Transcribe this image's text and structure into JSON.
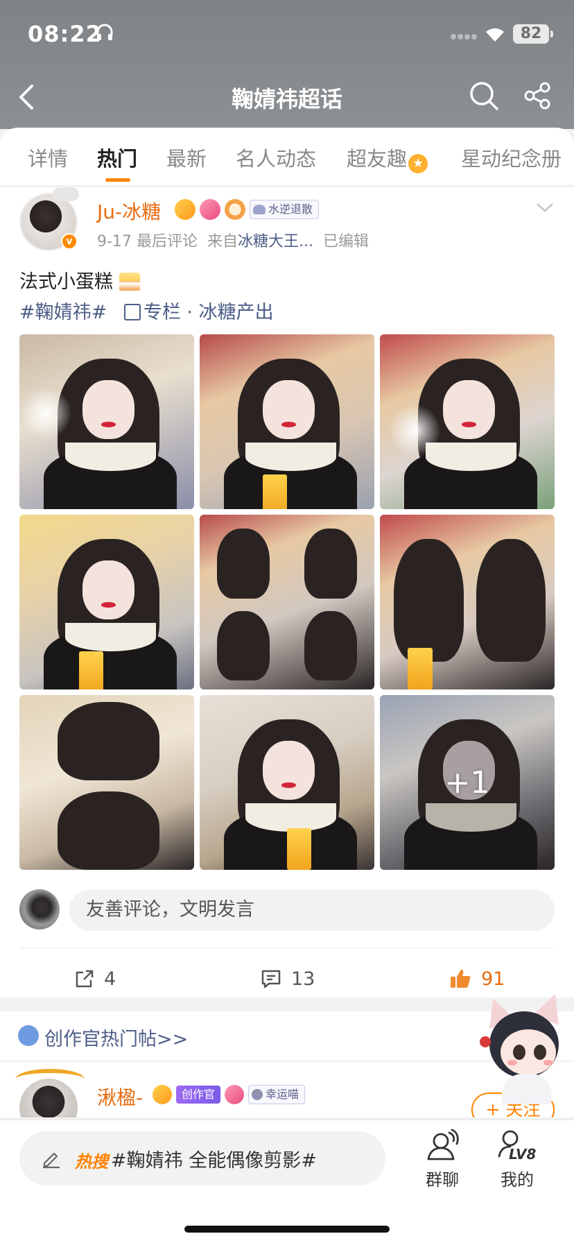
{
  "status_bar": {
    "time": "08:22",
    "battery": "82"
  },
  "nav": {
    "title": "鞠婧祎超话"
  },
  "tabs": [
    {
      "label": "详情",
      "active": false
    },
    {
      "label": "热门",
      "active": true
    },
    {
      "label": "最新",
      "active": false
    },
    {
      "label": "名人动态",
      "active": false
    },
    {
      "label": "超友趣",
      "active": false
    },
    {
      "label": "星动纪念册",
      "active": false
    }
  ],
  "post": {
    "author": "Ju-冰糖",
    "badge_tag": "水逆退散",
    "meta_date": "9-17",
    "meta_last": "最后评论",
    "meta_from": "来自",
    "meta_source": "冰糖大王...",
    "meta_edited": "已编辑",
    "text": "法式小蛋糕",
    "hashtag": "#鞠婧祎#",
    "column": "专栏 · 冰糖产出",
    "more_photos": "+1",
    "comment_placeholder": "友善评论，文明发言",
    "reposts": "4",
    "comments": "13",
    "likes": "91"
  },
  "hot_section": {
    "label": "创作官热门帖>>"
  },
  "post2": {
    "author": "湫楹-",
    "creator_tag": "创作官",
    "lucky_tag": "幸运喵",
    "follow": "+ 关注"
  },
  "bottom": {
    "hot_tag": "热搜",
    "hot_text": "#鞠婧祎 全能偶像剪影#",
    "group_chat": "群聊",
    "me": "我的",
    "level": "LV8"
  },
  "colors": {
    "accent": "#ff8200",
    "link": "#4d5d88",
    "author": "#e86b10"
  }
}
